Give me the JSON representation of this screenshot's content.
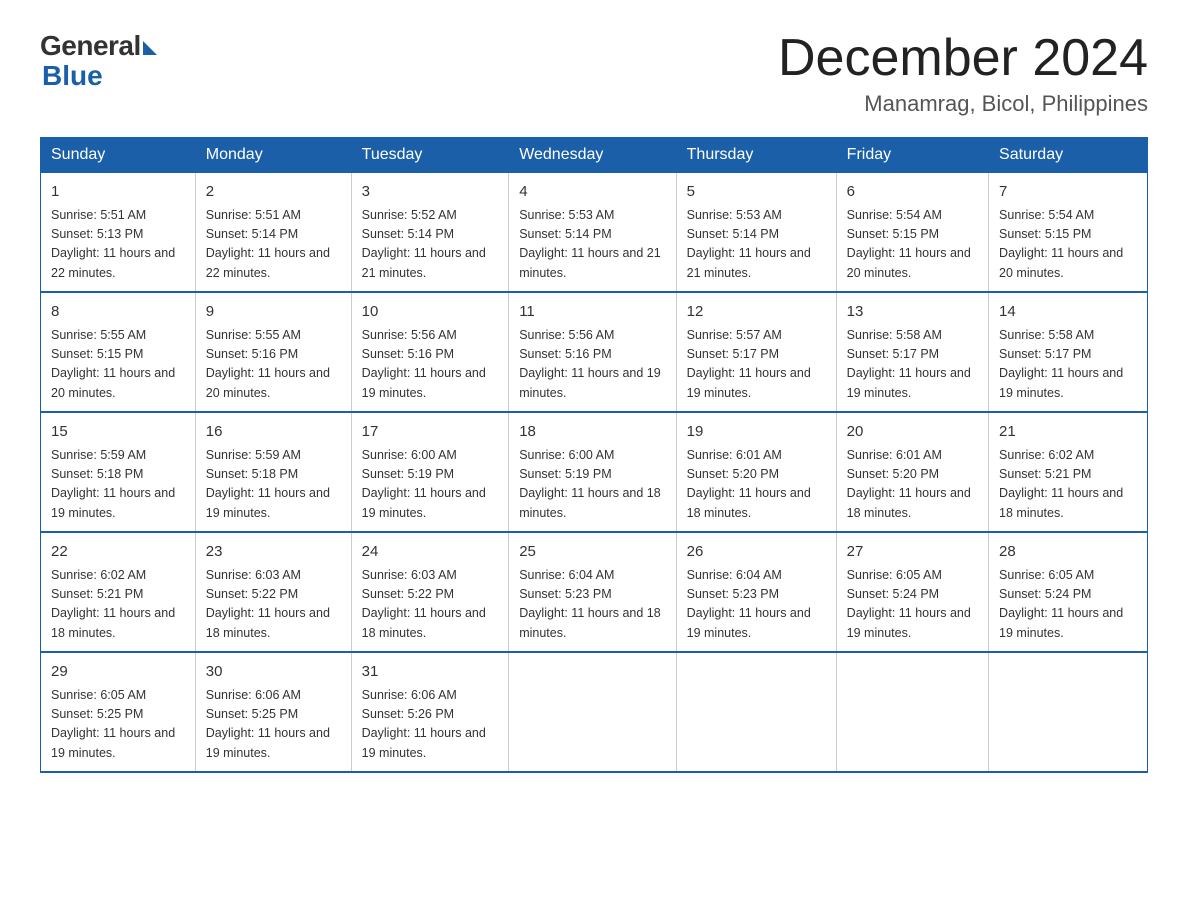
{
  "logo": {
    "general": "General",
    "blue": "Blue"
  },
  "title": "December 2024",
  "location": "Manamrag, Bicol, Philippines",
  "days_of_week": [
    "Sunday",
    "Monday",
    "Tuesday",
    "Wednesday",
    "Thursday",
    "Friday",
    "Saturday"
  ],
  "weeks": [
    [
      {
        "day": "1",
        "sunrise": "5:51 AM",
        "sunset": "5:13 PM",
        "daylight": "11 hours and 22 minutes."
      },
      {
        "day": "2",
        "sunrise": "5:51 AM",
        "sunset": "5:14 PM",
        "daylight": "11 hours and 22 minutes."
      },
      {
        "day": "3",
        "sunrise": "5:52 AM",
        "sunset": "5:14 PM",
        "daylight": "11 hours and 21 minutes."
      },
      {
        "day": "4",
        "sunrise": "5:53 AM",
        "sunset": "5:14 PM",
        "daylight": "11 hours and 21 minutes."
      },
      {
        "day": "5",
        "sunrise": "5:53 AM",
        "sunset": "5:14 PM",
        "daylight": "11 hours and 21 minutes."
      },
      {
        "day": "6",
        "sunrise": "5:54 AM",
        "sunset": "5:15 PM",
        "daylight": "11 hours and 20 minutes."
      },
      {
        "day": "7",
        "sunrise": "5:54 AM",
        "sunset": "5:15 PM",
        "daylight": "11 hours and 20 minutes."
      }
    ],
    [
      {
        "day": "8",
        "sunrise": "5:55 AM",
        "sunset": "5:15 PM",
        "daylight": "11 hours and 20 minutes."
      },
      {
        "day": "9",
        "sunrise": "5:55 AM",
        "sunset": "5:16 PM",
        "daylight": "11 hours and 20 minutes."
      },
      {
        "day": "10",
        "sunrise": "5:56 AM",
        "sunset": "5:16 PM",
        "daylight": "11 hours and 19 minutes."
      },
      {
        "day": "11",
        "sunrise": "5:56 AM",
        "sunset": "5:16 PM",
        "daylight": "11 hours and 19 minutes."
      },
      {
        "day": "12",
        "sunrise": "5:57 AM",
        "sunset": "5:17 PM",
        "daylight": "11 hours and 19 minutes."
      },
      {
        "day": "13",
        "sunrise": "5:58 AM",
        "sunset": "5:17 PM",
        "daylight": "11 hours and 19 minutes."
      },
      {
        "day": "14",
        "sunrise": "5:58 AM",
        "sunset": "5:17 PM",
        "daylight": "11 hours and 19 minutes."
      }
    ],
    [
      {
        "day": "15",
        "sunrise": "5:59 AM",
        "sunset": "5:18 PM",
        "daylight": "11 hours and 19 minutes."
      },
      {
        "day": "16",
        "sunrise": "5:59 AM",
        "sunset": "5:18 PM",
        "daylight": "11 hours and 19 minutes."
      },
      {
        "day": "17",
        "sunrise": "6:00 AM",
        "sunset": "5:19 PM",
        "daylight": "11 hours and 19 minutes."
      },
      {
        "day": "18",
        "sunrise": "6:00 AM",
        "sunset": "5:19 PM",
        "daylight": "11 hours and 18 minutes."
      },
      {
        "day": "19",
        "sunrise": "6:01 AM",
        "sunset": "5:20 PM",
        "daylight": "11 hours and 18 minutes."
      },
      {
        "day": "20",
        "sunrise": "6:01 AM",
        "sunset": "5:20 PM",
        "daylight": "11 hours and 18 minutes."
      },
      {
        "day": "21",
        "sunrise": "6:02 AM",
        "sunset": "5:21 PM",
        "daylight": "11 hours and 18 minutes."
      }
    ],
    [
      {
        "day": "22",
        "sunrise": "6:02 AM",
        "sunset": "5:21 PM",
        "daylight": "11 hours and 18 minutes."
      },
      {
        "day": "23",
        "sunrise": "6:03 AM",
        "sunset": "5:22 PM",
        "daylight": "11 hours and 18 minutes."
      },
      {
        "day": "24",
        "sunrise": "6:03 AM",
        "sunset": "5:22 PM",
        "daylight": "11 hours and 18 minutes."
      },
      {
        "day": "25",
        "sunrise": "6:04 AM",
        "sunset": "5:23 PM",
        "daylight": "11 hours and 18 minutes."
      },
      {
        "day": "26",
        "sunrise": "6:04 AM",
        "sunset": "5:23 PM",
        "daylight": "11 hours and 19 minutes."
      },
      {
        "day": "27",
        "sunrise": "6:05 AM",
        "sunset": "5:24 PM",
        "daylight": "11 hours and 19 minutes."
      },
      {
        "day": "28",
        "sunrise": "6:05 AM",
        "sunset": "5:24 PM",
        "daylight": "11 hours and 19 minutes."
      }
    ],
    [
      {
        "day": "29",
        "sunrise": "6:05 AM",
        "sunset": "5:25 PM",
        "daylight": "11 hours and 19 minutes."
      },
      {
        "day": "30",
        "sunrise": "6:06 AM",
        "sunset": "5:25 PM",
        "daylight": "11 hours and 19 minutes."
      },
      {
        "day": "31",
        "sunrise": "6:06 AM",
        "sunset": "5:26 PM",
        "daylight": "11 hours and 19 minutes."
      },
      null,
      null,
      null,
      null
    ]
  ]
}
